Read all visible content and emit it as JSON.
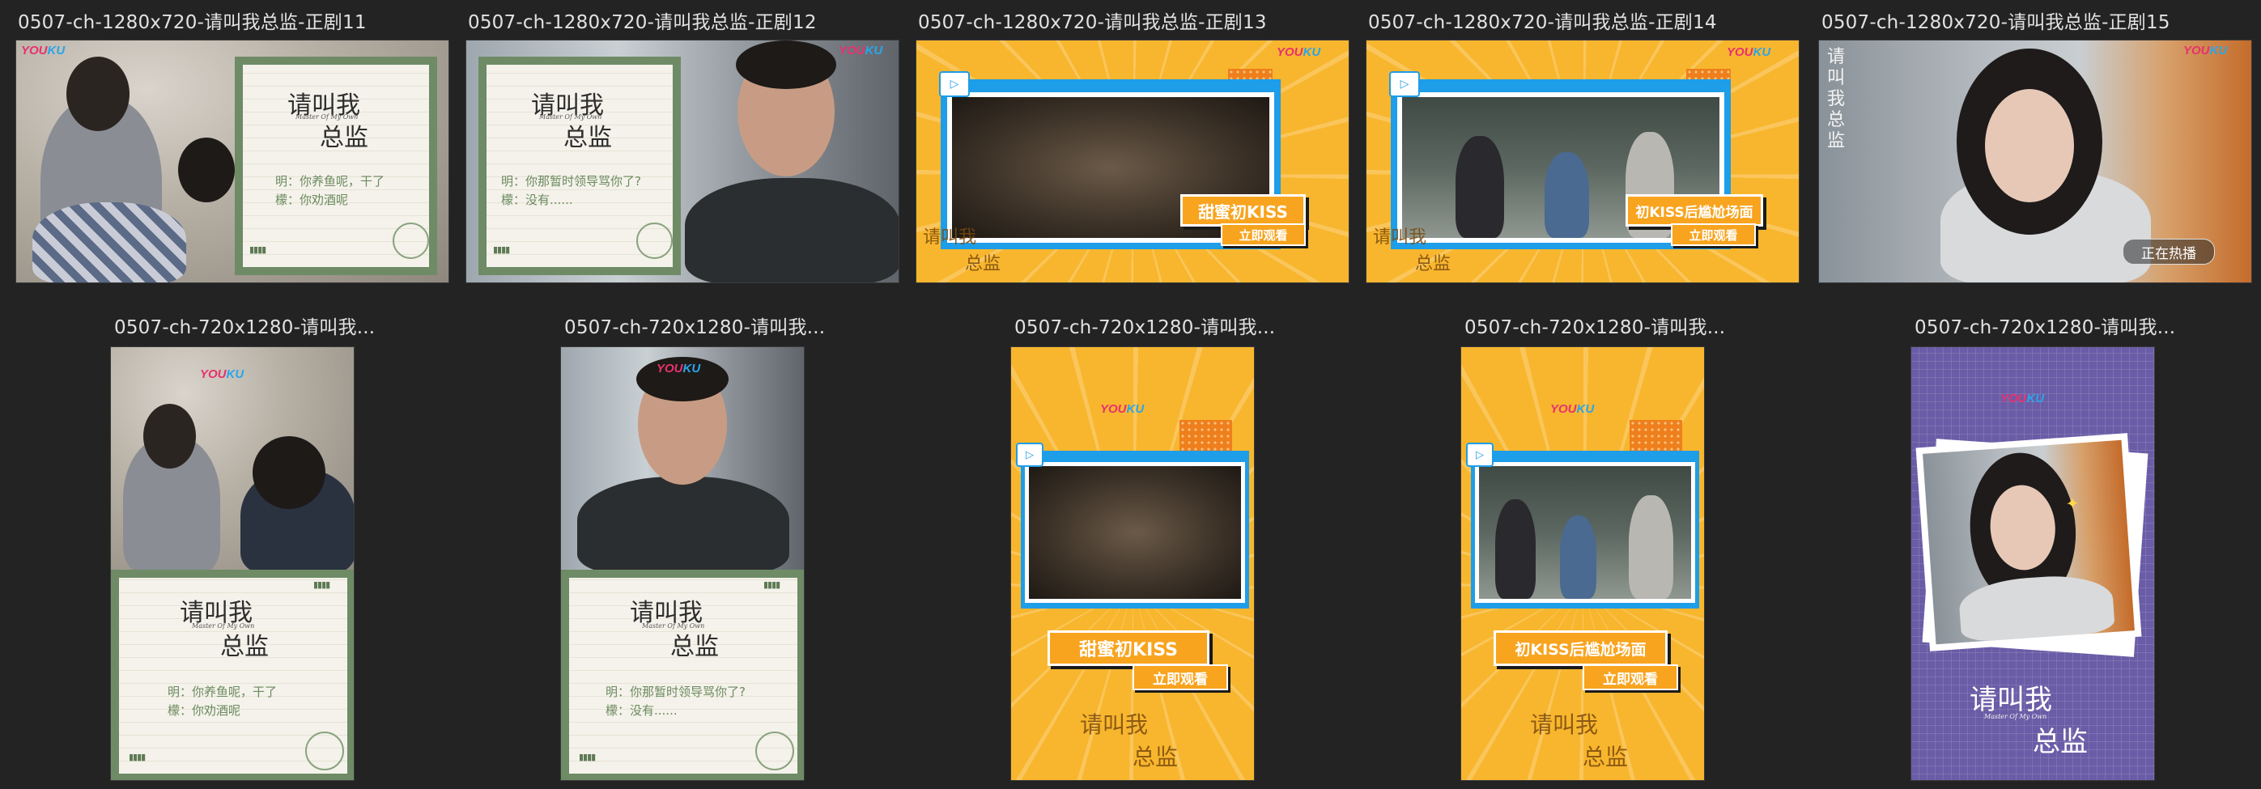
{
  "thumbnails": [
    {
      "caption": "0507-ch-1280x720-请叫我总监-正剧11"
    },
    {
      "caption": "0507-ch-1280x720-请叫我总监-正剧12"
    },
    {
      "caption": "0507-ch-1280x720-请叫我总监-正剧13"
    },
    {
      "caption": "0507-ch-1280x720-请叫我总监-正剧14"
    },
    {
      "caption": "0507-ch-1280x720-请叫我总监-正剧15"
    },
    {
      "caption": "0507-ch-720x1280-请叫我..."
    },
    {
      "caption": "0507-ch-720x1280-请叫我..."
    },
    {
      "caption": "0507-ch-720x1280-请叫我..."
    },
    {
      "caption": "0507-ch-720x1280-请叫我..."
    },
    {
      "caption": "0507-ch-720x1280-请叫我..."
    }
  ],
  "poster": {
    "title_line1": "请叫我",
    "title_line2": "总监",
    "subtitle": "Master Of My Own",
    "brand_you": "YOU",
    "brand_ku": "KU",
    "brand_arrow": "▶",
    "dots": "▮▮▮▮",
    "dialog_a_line1": "明：你养鱼呢，干了",
    "dialog_a_line2": "檬：你劝酒呢",
    "dialog_b_line1": "明：你那暂时领导骂你了?",
    "dialog_b_line2": "檬：没有......",
    "badge_kiss": "甜蜜初KISS",
    "badge_awkward": "初KISS后尴尬场面",
    "watch_now": "立即观看",
    "hot_playing": "正在热播",
    "vertical_title": "请叫我总监"
  },
  "colors": {
    "background": "#232323",
    "green_frame": "#6e8b66",
    "yellow_poster": "#f8b62e",
    "blue_window": "#1e9de8",
    "orange_badge": "#f8a41f",
    "purple_poster": "#6a5ca6",
    "youku_pink": "#e8316e",
    "youku_blue": "#2aa6e8"
  }
}
